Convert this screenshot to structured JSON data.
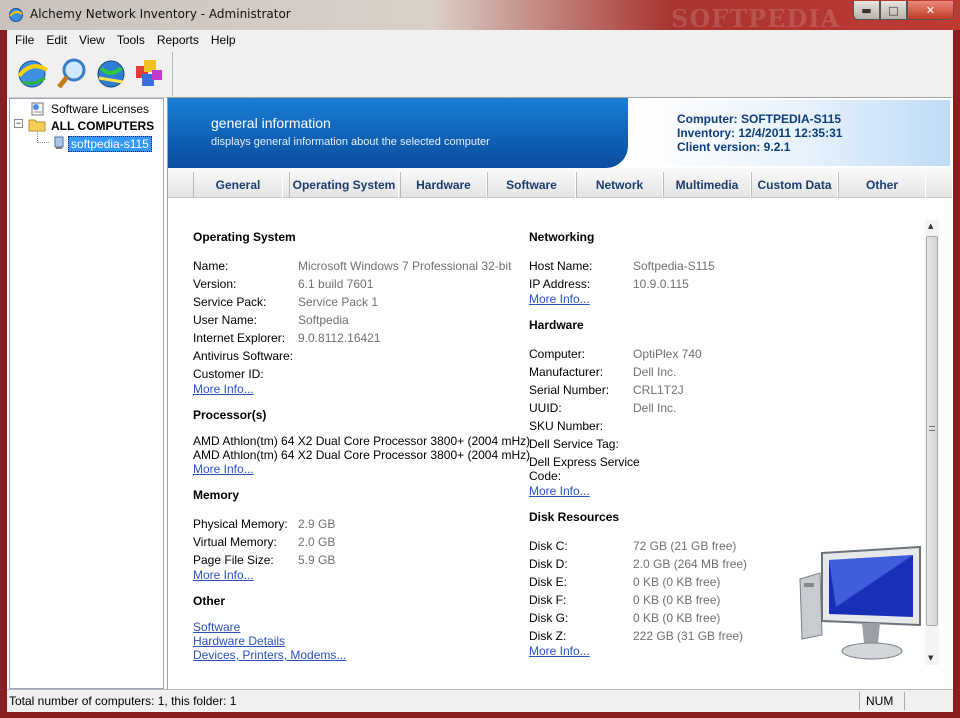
{
  "window": {
    "title": "Alchemy Network Inventory - Administrator",
    "watermark": "SOFTPEDIA"
  },
  "menu": [
    "File",
    "Edit",
    "View",
    "Tools",
    "Reports",
    "Help"
  ],
  "tree": {
    "software_licenses": "Software Licenses",
    "all_computers": "ALL COMPUTERS",
    "selected_computer": "softpedia-s115"
  },
  "banner": {
    "title": "general information",
    "subtitle": "displays general information about the selected computer",
    "computer": "Computer: SOFTPEDIA-S115",
    "inventory": "Inventory: 12/4/2011 12:35:31",
    "client_version": "Client version: 9.2.1"
  },
  "tabs": [
    "General",
    "Operating System",
    "Hardware",
    "Software",
    "Network",
    "Multimedia",
    "Custom Data",
    "Other"
  ],
  "os": {
    "heading": "Operating System",
    "rows": [
      {
        "label": "Name:",
        "value": "Microsoft Windows 7 Professional 32-bit"
      },
      {
        "label": "Version:",
        "value": "6.1 build 7601"
      },
      {
        "label": "Service Pack:",
        "value": "Service Pack 1"
      },
      {
        "label": "User Name:",
        "value": "Softpedia"
      },
      {
        "label": "Internet Explorer:",
        "value": "9.0.8112.16421"
      },
      {
        "label": "Antivirus Software:",
        "value": ""
      },
      {
        "label": "Customer ID:",
        "value": ""
      }
    ],
    "more": "More Info..."
  },
  "processor": {
    "heading": "Processor(s)",
    "lines": [
      "AMD Athlon(tm) 64 X2 Dual Core Processor 3800+ (2004 mHz)",
      "AMD Athlon(tm) 64 X2 Dual Core Processor 3800+ (2004 mHz)"
    ],
    "more": "More Info..."
  },
  "memory": {
    "heading": "Memory",
    "rows": [
      {
        "label": "Physical Memory:",
        "value": "2.9 GB"
      },
      {
        "label": "Virtual Memory:",
        "value": "2.0 GB"
      },
      {
        "label": "Page File Size:",
        "value": "5.9 GB"
      }
    ],
    "more": "More Info..."
  },
  "other": {
    "heading": "Other",
    "links": [
      "Software",
      "Hardware Details",
      "Devices, Printers, Modems..."
    ]
  },
  "networking": {
    "heading": "Networking",
    "rows": [
      {
        "label": "Host Name:",
        "value": "Softpedia-S115"
      },
      {
        "label": "IP Address:",
        "value": "10.9.0.115"
      }
    ],
    "more": "More Info..."
  },
  "hardware": {
    "heading": "Hardware",
    "rows": [
      {
        "label": "Computer:",
        "value": "OptiPlex 740"
      },
      {
        "label": "Manufacturer:",
        "value": "Dell Inc."
      },
      {
        "label": "Serial Number:",
        "value": "CRL1T2J"
      },
      {
        "label": "UUID:",
        "value": "Dell Inc."
      },
      {
        "label": "SKU Number:",
        "value": ""
      },
      {
        "label": "Dell Service Tag:",
        "value": ""
      }
    ],
    "express_label_1": "Dell Express Service",
    "express_label_2": "Code:",
    "more": "More Info..."
  },
  "disk": {
    "heading": "Disk Resources",
    "rows": [
      {
        "label": "Disk C:",
        "value": "72 GB (21 GB free)"
      },
      {
        "label": "Disk D:",
        "value": "2.0 GB (264 MB free)"
      },
      {
        "label": "Disk E:",
        "value": "0 KB (0 KB free)"
      },
      {
        "label": "Disk F:",
        "value": "0 KB (0 KB free)"
      },
      {
        "label": "Disk G:",
        "value": "0 KB (0 KB free)"
      },
      {
        "label": "Disk Z:",
        "value": "222 GB (31 GB free)"
      }
    ],
    "more": "More Info..."
  },
  "status": {
    "text": "Total number of computers: 1, this folder: 1",
    "num": "NUM"
  },
  "colors": {
    "accent": "#0f5fb3",
    "link": "#2a52be",
    "selection": "#3399ff"
  }
}
